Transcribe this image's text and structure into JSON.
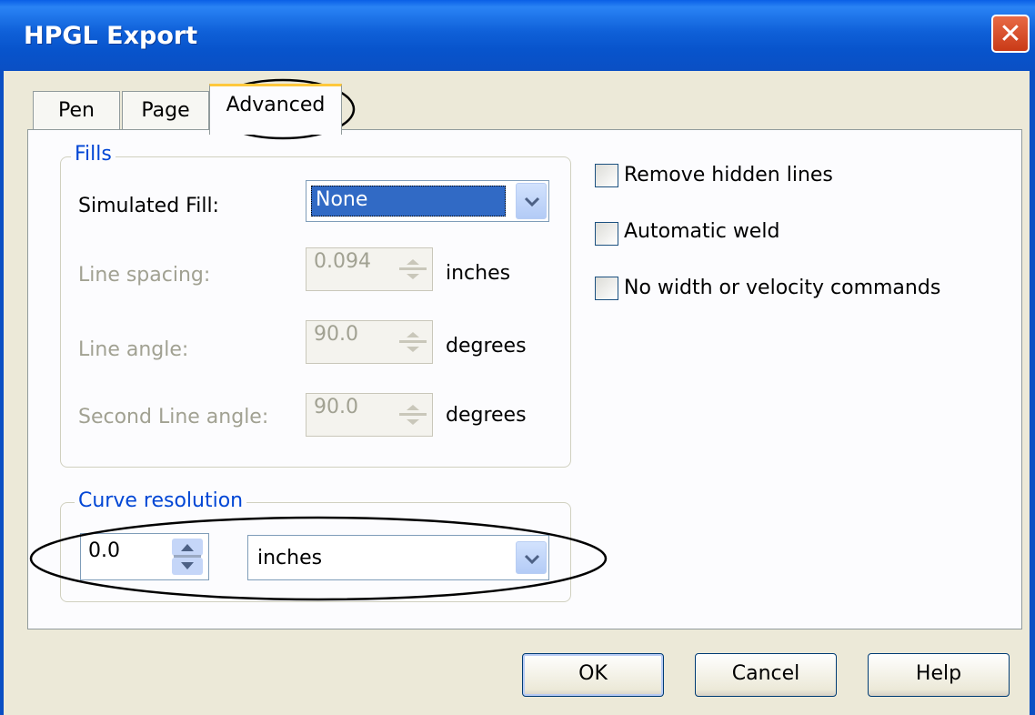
{
  "window": {
    "title": "HPGL Export",
    "close_glyph": "✕"
  },
  "tabs": [
    {
      "label": "Pen",
      "selected": false
    },
    {
      "label": "Page",
      "selected": false
    },
    {
      "label": "Advanced",
      "selected": true
    }
  ],
  "fills": {
    "legend": "Fills",
    "simulated_fill": {
      "label": "Simulated Fill:",
      "value": "None"
    },
    "line_spacing": {
      "label": "Line spacing:",
      "value": "0.094",
      "unit": "inches"
    },
    "line_angle": {
      "label": "Line angle:",
      "value": "90.0",
      "unit": "degrees"
    },
    "second_line_angle": {
      "label": "Second Line angle:",
      "value": "90.0",
      "unit": "degrees"
    }
  },
  "curve_resolution": {
    "legend": "Curve resolution",
    "value": "0.0",
    "unit": "inches"
  },
  "options": [
    {
      "label": "Remove hidden lines",
      "checked": false
    },
    {
      "label": "Automatic weld",
      "checked": false
    },
    {
      "label": "No width or velocity commands",
      "checked": false
    }
  ],
  "buttons": {
    "ok": "OK",
    "cancel": "Cancel",
    "help": "Help"
  },
  "colors": {
    "titlebar": "#0a5fe6",
    "group_legend": "#0046d5",
    "disabled_text": "#a1a192",
    "selected_tab_accent": "#ffc83c"
  }
}
